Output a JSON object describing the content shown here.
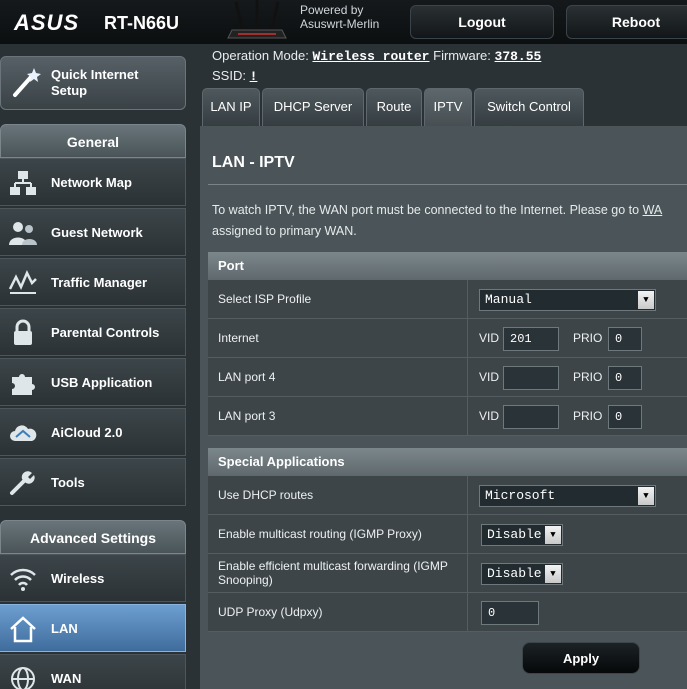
{
  "header": {
    "brand": "ASUS",
    "model": "RT-N66U",
    "powered_line1": "Powered by",
    "powered_line2": "Asuswrt-Merlin",
    "logout_label": "Logout",
    "reboot_label": "Reboot"
  },
  "status": {
    "mode_label": "Operation Mode:",
    "mode_value": "Wireless router",
    "firmware_label": "Firmware:",
    "firmware_value": "378.55",
    "ssid_label": "SSID:",
    "ssid_value": "!"
  },
  "sidebar": {
    "quick_setup_line1": "Quick Internet",
    "quick_setup_line2": "Setup",
    "general_header": "General",
    "general_items": [
      {
        "label": "Network Map",
        "icon": "network-map-icon"
      },
      {
        "label": "Guest Network",
        "icon": "guest-network-icon"
      },
      {
        "label": "Traffic Manager",
        "icon": "traffic-manager-icon"
      },
      {
        "label": "Parental Controls",
        "icon": "lock-icon"
      },
      {
        "label": "USB Application",
        "icon": "puzzle-icon"
      },
      {
        "label": "AiCloud 2.0",
        "icon": "cloud-icon"
      },
      {
        "label": "Tools",
        "icon": "wrench-icon"
      }
    ],
    "advanced_header": "Advanced Settings",
    "advanced_items": [
      {
        "label": "Wireless",
        "icon": "wifi-icon"
      },
      {
        "label": "LAN",
        "icon": "home-icon",
        "active": true
      },
      {
        "label": "WAN",
        "icon": "globe-icon"
      }
    ]
  },
  "tabs": [
    {
      "label": "LAN IP"
    },
    {
      "label": "DHCP Server"
    },
    {
      "label": "Route"
    },
    {
      "label": "IPTV",
      "active": true
    },
    {
      "label": "Switch Control"
    }
  ],
  "main": {
    "title": "LAN - IPTV",
    "desc_line1": "To watch IPTV, the WAN port must be connected to the Internet. Please go to",
    "desc_link": "WA",
    "desc_line2": "assigned to primary WAN.",
    "port_header": "Port",
    "isp_profile_label": "Select ISP Profile",
    "isp_profile_value": "Manual",
    "vid_label": "VID",
    "prio_label": "PRIO",
    "internet_label": "Internet",
    "internet_vid": "201",
    "internet_prio": "0",
    "lan4_label": "LAN port 4",
    "lan4_vid": "",
    "lan4_prio": "0",
    "lan3_label": "LAN port 3",
    "lan3_vid": "",
    "lan3_prio": "0",
    "special_header": "Special Applications",
    "dhcp_routes_label": "Use DHCP routes",
    "dhcp_routes_value": "Microsoft",
    "multicast_label": "Enable multicast routing (IGMP Proxy)",
    "multicast_value": "Disable",
    "efficient_label": "Enable efficient multicast forwarding (IGMP Snooping)",
    "efficient_value": "Disable",
    "udpxy_label": "UDP Proxy (Udpxy)",
    "udpxy_value": "0",
    "apply_label": "Apply"
  },
  "colors": {
    "background": "#2b3236",
    "panel": "#4b5559",
    "active_nav": "#4f80b3"
  }
}
